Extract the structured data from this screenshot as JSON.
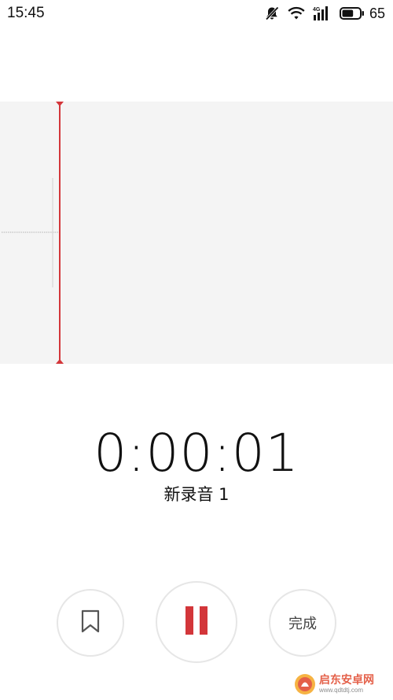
{
  "status_bar": {
    "time": "15:45",
    "network_label": "4G",
    "battery_percent": "65",
    "battery_level": 0.65,
    "icons": [
      "mute-bell-icon",
      "wifi-icon",
      "signal-icon",
      "battery-icon"
    ]
  },
  "waveform": {
    "background_color": "#f4f4f4",
    "playhead_color": "#d3363a"
  },
  "recording": {
    "elapsed": "0:00:01",
    "name": "新录音 1"
  },
  "controls": {
    "mark_icon": "bookmark-icon",
    "pause_icon": "pause-icon",
    "pause_color": "#d3363a",
    "done_label": "完成"
  },
  "watermark": {
    "name": "启东安卓网",
    "url": "www.qdtdtj.com"
  }
}
